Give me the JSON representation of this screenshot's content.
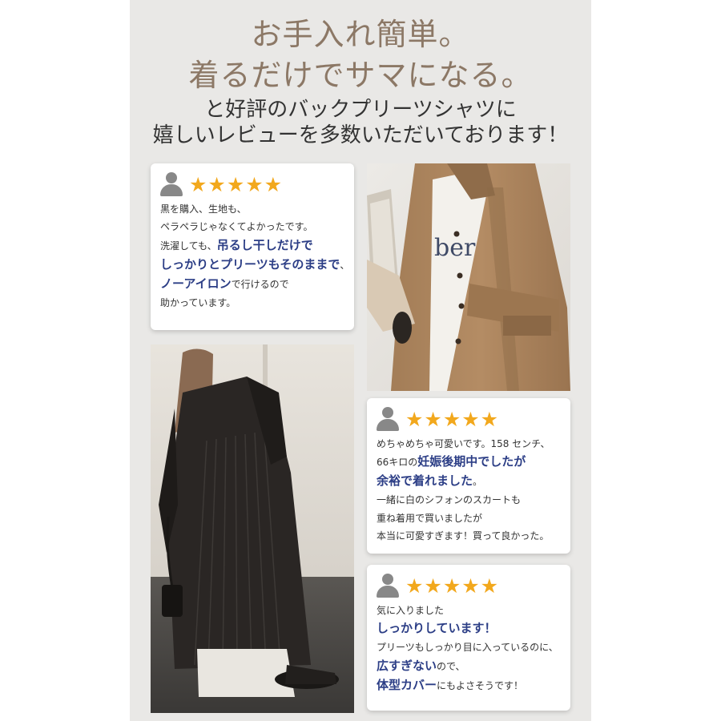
{
  "headline": {
    "line1": "お手入れ簡単。",
    "line2": "着るだけでサマになる。",
    "line3": "と好評のバックプリーツシャツに",
    "line4": "嬉しいレビューを多数いただいております！"
  },
  "colors": {
    "star": "#f2a81d",
    "highlight": "#2c3e86",
    "headline_brown": "#8c7866",
    "panel_bg": "#e9e8e6"
  },
  "reviews": [
    {
      "avatar_icon": "user-icon",
      "stars": "★★★★★",
      "rating": 5,
      "line1": "黒を購入、生地も、",
      "line2": "ペラペラじゃなくてよかったです。",
      "line3_pre": "洗濯しても、",
      "line3_hl": "吊るし干しだけで",
      "line4_hl": "しっかりとプリーツもそのままで",
      "line4_post": "、",
      "line5_hl": "ノーアイロン",
      "line5_post": "で行けるので",
      "line6": "助かっています。"
    },
    {
      "avatar_icon": "user-icon",
      "stars": "★★★★★",
      "rating": 5,
      "line1": "めちゃめちゃ可愛いです。158 センチ、",
      "line2_pre": "66キロの",
      "line2_hl": "妊娠後期中でしたが",
      "line3_hl": "余裕で着れました",
      "line3_post": "。",
      "line4": "一緒に白のシフォンのスカートも",
      "line5": "重ね着用で買いましたが",
      "line6": "本当に可愛すぎます！買って良かった。"
    },
    {
      "avatar_icon": "user-icon",
      "stars": "★★★★★",
      "rating": 5,
      "line1": "気に入りました",
      "line2_hl": "しっかりしています！",
      "line3": "プリーツもしっかり目に入っているのに、",
      "line4_hl": "広すぎない",
      "line4_post": "ので、",
      "line5_hl": "体型カバー",
      "line5_post": "にもよさそうです！"
    }
  ],
  "photos": {
    "front_logo_text": "ber"
  }
}
